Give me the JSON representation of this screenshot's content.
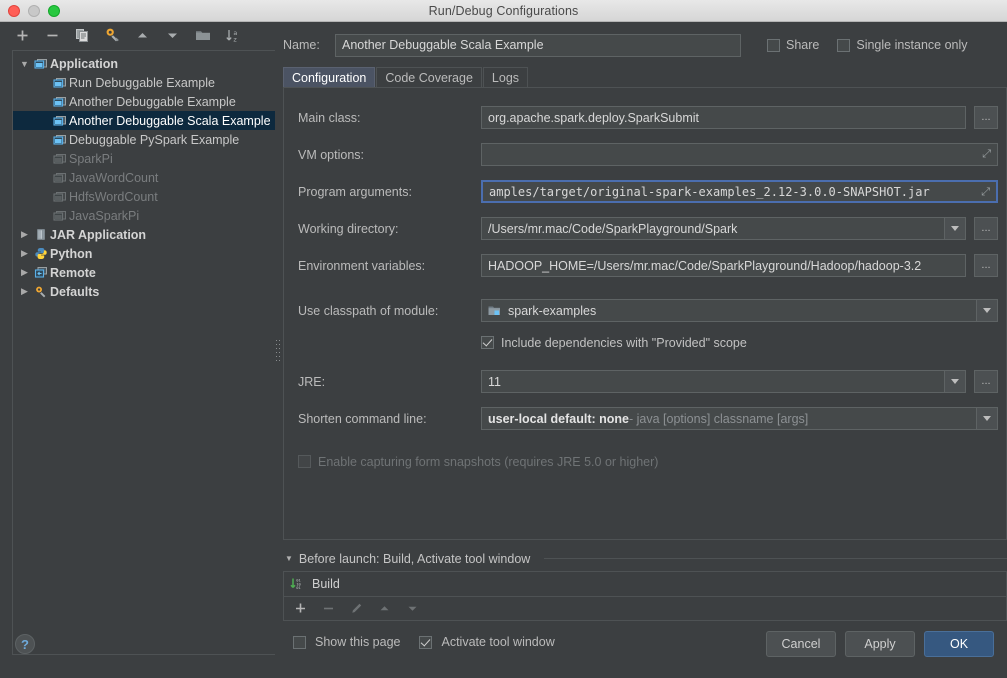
{
  "window": {
    "title": "Run/Debug Configurations",
    "traffic_lights": [
      "close-red",
      "minimize-gray",
      "zoom-green"
    ]
  },
  "sidebar": {
    "toolbar": [
      {
        "name": "add-configuration-button",
        "icon": "plus-icon",
        "label": "+"
      },
      {
        "name": "remove-configuration-button",
        "icon": "minus-icon",
        "label": "−"
      },
      {
        "name": "copy-configuration-button",
        "icon": "copy-icon",
        "label": "copy"
      },
      {
        "name": "edit-templates-button",
        "icon": "wrench-icon",
        "label": "templates"
      },
      {
        "name": "move-up-button",
        "icon": "triangle-up-icon",
        "label": "up"
      },
      {
        "name": "move-down-button",
        "icon": "triangle-down-icon",
        "label": "down"
      },
      {
        "name": "new-folder-button",
        "icon": "folder-icon",
        "label": "folder"
      },
      {
        "name": "sort-alphabetically-button",
        "icon": "sort-az-icon",
        "label": "sort"
      }
    ],
    "tree": [
      {
        "label": "Application",
        "icon": "application-icon",
        "level": 0,
        "expanded": true,
        "style": "group"
      },
      {
        "label": "Run Debuggable Example",
        "icon": "application-icon",
        "level": 1,
        "style": "normal"
      },
      {
        "label": "Another Debuggable Example",
        "icon": "application-icon",
        "level": 1,
        "style": "normal"
      },
      {
        "label": "Another Debuggable Scala Example",
        "icon": "application-icon",
        "level": 1,
        "style": "selected"
      },
      {
        "label": "Debuggable PySpark Example",
        "icon": "application-icon",
        "level": 1,
        "style": "normal"
      },
      {
        "label": "SparkPi",
        "icon": "application-icon",
        "level": 1,
        "style": "dim"
      },
      {
        "label": "JavaWordCount",
        "icon": "application-icon",
        "level": 1,
        "style": "dim"
      },
      {
        "label": "HdfsWordCount",
        "icon": "application-icon",
        "level": 1,
        "style": "dim"
      },
      {
        "label": "JavaSparkPi",
        "icon": "application-icon",
        "level": 1,
        "style": "dim"
      },
      {
        "label": "JAR Application",
        "icon": "jar-icon",
        "level": 0,
        "expanded": false,
        "style": "group"
      },
      {
        "label": "Python",
        "icon": "python-icon",
        "level": 0,
        "expanded": false,
        "style": "group"
      },
      {
        "label": "Remote",
        "icon": "remote-icon",
        "level": 0,
        "expanded": false,
        "style": "group"
      },
      {
        "label": "Defaults",
        "icon": "wrench-icon",
        "level": 0,
        "expanded": false,
        "style": "group"
      }
    ]
  },
  "header": {
    "name_label": "Name:",
    "name_value": "Another Debuggable Scala Example",
    "share_label": "Share",
    "share_checked": false,
    "single_instance_label": "Single instance only",
    "single_instance_checked": false
  },
  "tabs": [
    {
      "label": "Configuration",
      "active": true
    },
    {
      "label": "Code Coverage",
      "active": false
    },
    {
      "label": "Logs",
      "active": false
    }
  ],
  "form": {
    "main_class": {
      "label": "Main class:",
      "value": "org.apache.spark.deploy.SparkSubmit",
      "browse_label": "..."
    },
    "vm_options": {
      "label": "VM options:",
      "value": "",
      "expand_icon": "expand-icon"
    },
    "program_arguments": {
      "label": "Program arguments:",
      "value": "amples/target/original-spark-examples_2.12-3.0.0-SNAPSHOT.jar",
      "focused": true,
      "expand_icon": "expand-icon"
    },
    "working_directory": {
      "label": "Working directory:",
      "value": "/Users/mr.mac/Code/SparkPlayground/Spark",
      "browse_label": "..."
    },
    "environment_variables": {
      "label": "Environment variables:",
      "value": "HADOOP_HOME=/Users/mr.mac/Code/SparkPlayground/Hadoop/hadoop-3.2",
      "browse_label": "..."
    },
    "classpath_module": {
      "label": "Use classpath of module:",
      "value": "spark-examples",
      "icon": "module-icon"
    },
    "include_provided": {
      "label": "Include dependencies with \"Provided\" scope",
      "checked": true
    },
    "jre": {
      "label": "JRE:",
      "value": "11",
      "browse_label": "..."
    },
    "shorten_command_line": {
      "label": "Shorten command line:",
      "value_bold": "user-local default: none",
      "value_rest": " - java [options] classname [args]"
    },
    "form_snapshots": {
      "label": "Enable capturing form snapshots (requires JRE 5.0 or higher)",
      "checked": false,
      "disabled": true
    }
  },
  "before_launch": {
    "title": "Before launch: Build, Activate tool window",
    "items": [
      {
        "label": "Build",
        "icon": "build-icon"
      }
    ],
    "toolbar": [
      {
        "name": "add-task-button",
        "icon": "plus-icon",
        "label": "+"
      },
      {
        "name": "remove-task-button",
        "icon": "minus-icon",
        "label": "−"
      },
      {
        "name": "edit-task-button",
        "icon": "pencil-icon",
        "label": "edit"
      },
      {
        "name": "move-task-up-button",
        "icon": "triangle-up-icon",
        "label": "up"
      },
      {
        "name": "move-task-down-button",
        "icon": "triangle-down-icon",
        "label": "down"
      }
    ],
    "show_this_page": {
      "label": "Show this page",
      "checked": false
    },
    "activate_tool_window": {
      "label": "Activate tool window",
      "checked": true
    }
  },
  "footer": {
    "help_label": "?",
    "cancel_label": "Cancel",
    "apply_label": "Apply",
    "ok_label": "OK"
  },
  "colors": {
    "background": "#3c3f41",
    "field_background": "#45494a",
    "border": "#4e5254",
    "selection": "#0d293e",
    "accent": "#365880",
    "focus_border": "#4b6eaf",
    "tab_active": "#4b5363",
    "help_icon": "#6faadb"
  }
}
